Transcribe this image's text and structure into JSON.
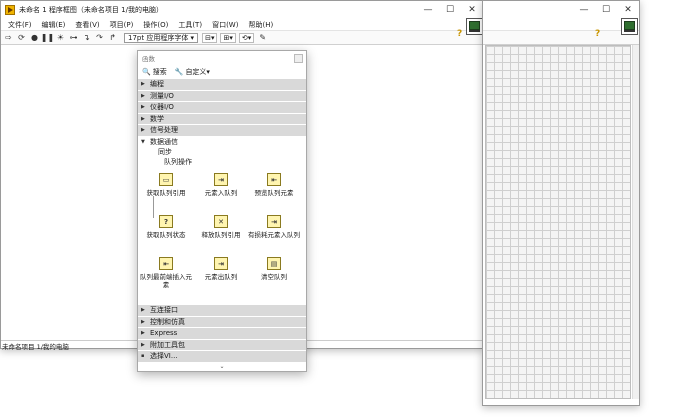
{
  "block_diagram": {
    "title": "未命名 1 程序框图（未命名项目 1/我的电脑）",
    "menu": [
      "文件(F)",
      "编辑(E)",
      "查看(V)",
      "项目(P)",
      "操作(O)",
      "工具(T)",
      "窗口(W)",
      "帮助(H)"
    ],
    "font_selector": "17pt 应用程序字体",
    "status": "未命名项目 1/我的电脑",
    "window_buttons": {
      "min": "—",
      "max": "☐",
      "close": "✕"
    }
  },
  "front_panel": {
    "window_buttons": {
      "min": "—",
      "max": "☐",
      "close": "✕"
    }
  },
  "palette": {
    "title": "函数",
    "search_label": "搜索",
    "customize_label": "自定义▾",
    "categories_top": [
      "编程",
      "测量I/O",
      "仪器I/O",
      "数学",
      "信号处理"
    ],
    "open_category": "数据通信",
    "sub_items": [
      "同步",
      "队列操作"
    ],
    "functions": [
      {
        "label": "获取队列引用",
        "icon": "obtain-queue-icon",
        "glyph": "▭"
      },
      {
        "label": "元素入队列",
        "icon": "enqueue-icon",
        "glyph": "⇥"
      },
      {
        "label": "预览队列元素",
        "icon": "preview-queue-icon",
        "glyph": "⇤"
      },
      {
        "label": "获取队列状态",
        "icon": "queue-status-icon",
        "glyph": "?"
      },
      {
        "label": "释放队列引用",
        "icon": "release-queue-icon",
        "glyph": "✕"
      },
      {
        "label": "有损耗元素入队列",
        "icon": "lossy-enqueue-icon",
        "glyph": "⇥"
      },
      {
        "label": "队列最前端插入元素",
        "icon": "enqueue-front-icon",
        "glyph": "⇤"
      },
      {
        "label": "元素出队列",
        "icon": "dequeue-icon",
        "glyph": "⇥"
      },
      {
        "label": "清空队列",
        "icon": "flush-queue-icon",
        "glyph": "▤"
      }
    ],
    "categories_bottom": [
      "互连接口",
      "控制和仿真",
      "Express",
      "附加工具包"
    ],
    "select_vi": "选择VI...",
    "more": "⌄"
  }
}
